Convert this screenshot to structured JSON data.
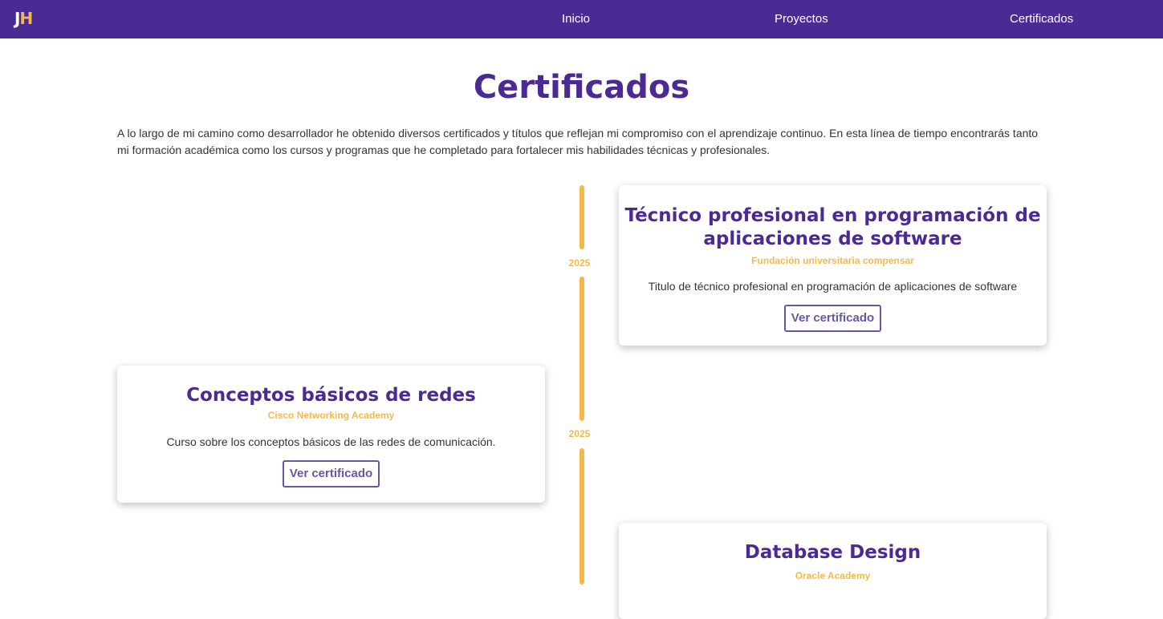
{
  "nav": {
    "logo_j": "J",
    "logo_h": "H",
    "links": [
      "Inicio",
      "Proyectos",
      "Certificados"
    ]
  },
  "page": {
    "title": "Certificados",
    "intro": "A lo largo de mi camino como desarrollador he obtenido diversos certificados y títulos que reflejan mi compromiso con el aprendizaje continuo. En esta línea de tiempo encontrarás tanto mi formación académica como los cursos y programas que he completado para fortalecer mis habilidades técnicas y profesionales."
  },
  "timeline": {
    "entries": [
      {
        "year": "2025",
        "title": "Técnico profesional en programación de aplicaciones de software",
        "organization": "Fundación universitaria compensar",
        "description": "Titulo de técnico profesional en programación de aplicaciones de software",
        "button_label": "Ver certificado"
      },
      {
        "year": "2025",
        "title": "Conceptos básicos de redes",
        "organization": "Cisco Networking Academy",
        "description": "Curso sobre los conceptos básicos de las redes de comunicación.",
        "button_label": "Ver certificado"
      },
      {
        "title": "Database Design",
        "organization": "Oracle Academy"
      }
    ]
  },
  "colors": {
    "primary": "#4b2a93",
    "accent": "#f5b94a",
    "button": "#6b55a3",
    "text": "#333333",
    "background": "#ffffff"
  }
}
